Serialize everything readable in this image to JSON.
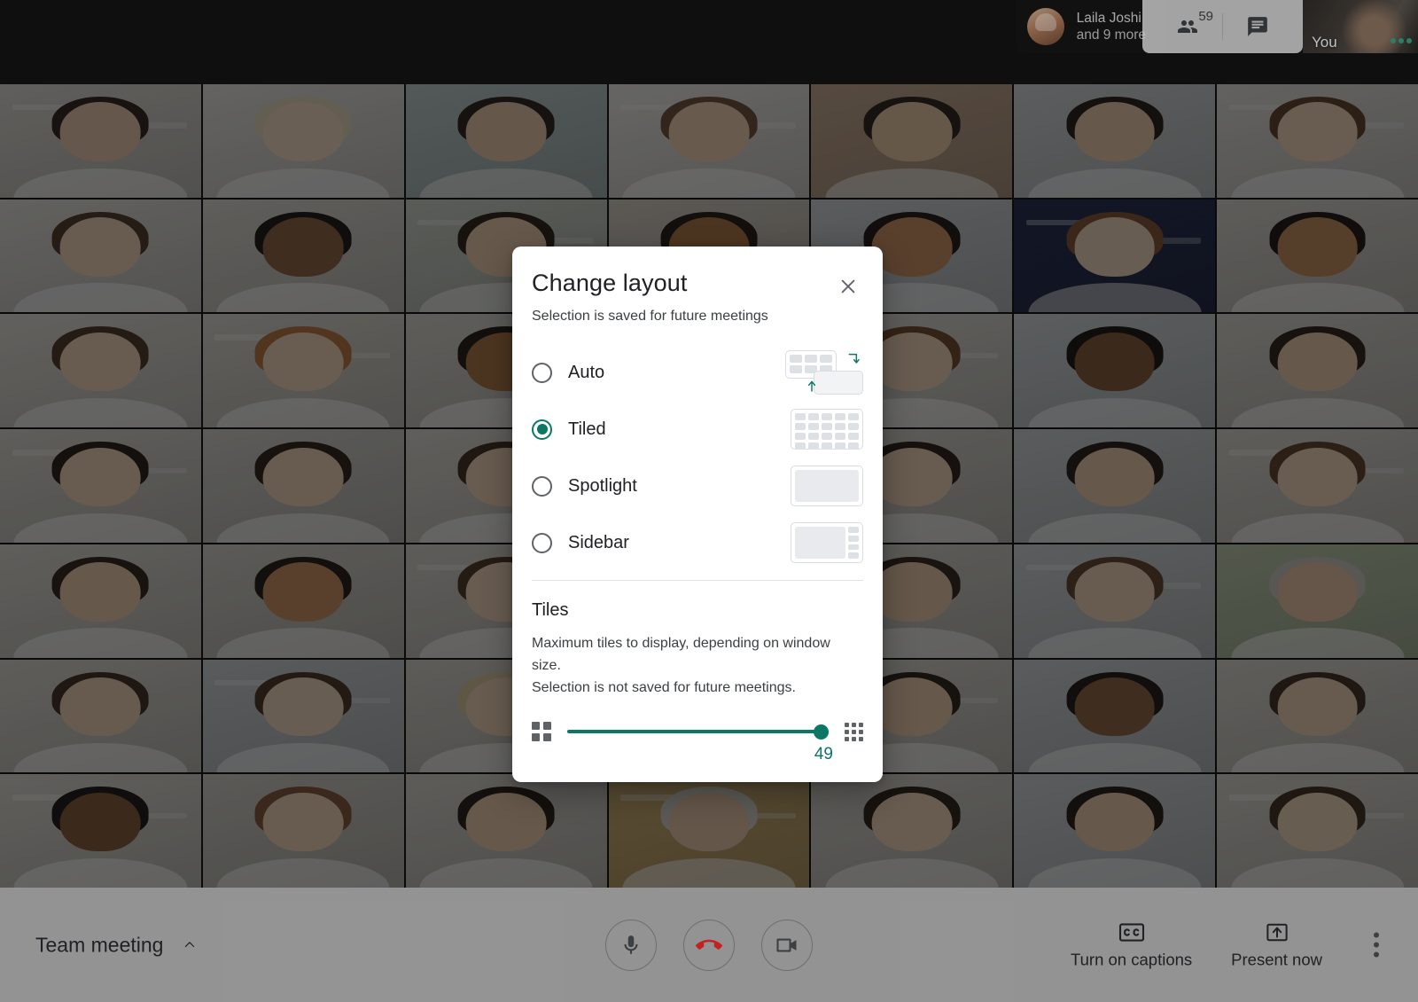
{
  "app": {
    "meeting_name": "Team meeting",
    "self_label": "You"
  },
  "topbar": {
    "participant_name": "Laila Joshi",
    "participant_more": "and 9 more",
    "participants_icon": "people-icon",
    "participants_count": "59",
    "chat_icon": "chat-icon",
    "avatar_name": "avatar"
  },
  "dialog": {
    "title": "Change layout",
    "subtitle": "Selection is saved for future meetings",
    "close_icon": "close-icon",
    "options": [
      {
        "label": "Auto",
        "selected": false,
        "thumb": "auto-layout-thumbnail"
      },
      {
        "label": "Tiled",
        "selected": true,
        "thumb": "tiled-layout-thumbnail"
      },
      {
        "label": "Spotlight",
        "selected": false,
        "thumb": "spotlight-layout-thumbnail"
      },
      {
        "label": "Sidebar",
        "selected": false,
        "thumb": "sidebar-layout-thumbnail"
      }
    ],
    "tiles": {
      "heading": "Tiles",
      "description_line1": "Maximum tiles to display, depending on window size.",
      "description_line2": "Selection is not saved for future meetings.",
      "slider_value": "49",
      "slider_min_icon": "grid-2x2-icon",
      "slider_max_icon": "grid-3x3-icon",
      "slider_percent": 100
    }
  },
  "bottombar": {
    "meeting_label": "Team meeting",
    "expand_icon": "chevron-up-icon",
    "mic_icon": "microphone-icon",
    "hangup_icon": "end-call-icon",
    "camera_icon": "camera-icon",
    "captions_label": "Turn on captions",
    "captions_icon": "closed-captions-icon",
    "present_label": "Present now",
    "present_icon": "present-screen-icon",
    "more_icon": "more-options-icon"
  },
  "colors": {
    "accent_green": "#0b7764",
    "hangup_red": "#c5221f",
    "dialog_bg": "#ffffff",
    "text_primary": "#202124",
    "text_secondary": "#3c4043"
  },
  "grid": {
    "columns": 7,
    "rows": 7,
    "tiles": [
      {
        "skin": "#e6c4a8",
        "hair": "#2b1d16",
        "wall": "#d9d6cf"
      },
      {
        "skin": "#f0d6bd",
        "hair": "#ded4b6",
        "wall": "#e3e1dc"
      },
      {
        "skin": "#e7c5a4",
        "hair": "#241a14",
        "wall": "#b9c9c7"
      },
      {
        "skin": "#eccdae",
        "hair": "#6b4a33",
        "wall": "#e9e7e2"
      },
      {
        "skin": "#e9c7a3",
        "hair": "#231a14",
        "wall": "#c2a58b"
      },
      {
        "skin": "#e8c6a5",
        "hair": "#1f1711",
        "wall": "#cfd4d6"
      },
      {
        "skin": "#f0d3b6",
        "hair": "#5a3a24",
        "wall": "#e0ded8"
      },
      {
        "skin": "#edd0b4",
        "hair": "#4b3424",
        "wall": "#dedcd6"
      },
      {
        "skin": "#8a5c3b",
        "hair": "#171210",
        "wall": "#d8d5cd"
      },
      {
        "skin": "#dcb georg",
        "hair": "#2a1c13",
        "wall": "#c9cfc4"
      },
      {
        "skin": "#a9713f",
        "hair": "#1b1410",
        "wall": "#cfc9bd"
      },
      {
        "skin": "#c98d5e",
        "hair": "#1a1310",
        "wall": "#cbd0d3"
      },
      {
        "skin": "#edd2b8",
        "hair": "#7d4f2c",
        "wall": "#1b2448"
      },
      {
        "skin": "#c28a57",
        "hair": "#160f0c",
        "wall": "#d4d1c9"
      },
      {
        "skin": "#ecd0b2",
        "hair": "#4a3322",
        "wall": "#dedbd3"
      },
      {
        "skin": "#eed2b5",
        "hair": "#b5703a",
        "wall": "#dad6cd"
      },
      {
        "skin": "#a9713f",
        "hair": "#1d1510",
        "wall": "#d6d3cb"
      },
      {
        "skin": "#e7c6a4",
        "hair": "#2b1e15",
        "wall": "#cdd2d5"
      },
      {
        "skin": "#ecd0b3",
        "hair": "#6d4526",
        "wall": "#d9d7d0"
      },
      {
        "skin": "#7e5231",
        "hair": "#14100d",
        "wall": "#cdd3d6"
      },
      {
        "skin": "#e9c8a6",
        "hair": "#2a1d14",
        "wall": "#d5d2ca"
      },
      {
        "skin": "#ead0b0",
        "hair": "#1f1712",
        "wall": "#d7d4cc"
      },
      {
        "skin": "#ecd0b4",
        "hair": "#2a1d15",
        "wall": "#cfcdc7"
      },
      {
        "skin": "#eccfb0",
        "hair": "#3a2819",
        "wall": "#d9d6ce"
      },
      {
        "skin": "#e8c8a7",
        "hair": "#241a13",
        "wall": "#cdd2cf"
      },
      {
        "skin": "#eccfb1",
        "hair": "#241913",
        "wall": "#d2cfc7"
      },
      {
        "skin": "#e9c9a8",
        "hair": "#20160f",
        "wall": "#cbd0d2"
      },
      {
        "skin": "#eed3b6",
        "hair": "#5b3c24",
        "wall": "#d6d3cb"
      },
      {
        "skin": "#e9c8a7",
        "hair": "#2b1e15",
        "wall": "#d8d5cd"
      },
      {
        "skin": "#c98d5e",
        "hair": "#1c1410",
        "wall": "#cfccc4"
      },
      {
        "skin": "#edd1b4",
        "hair": "#46301f",
        "wall": "#d4d1c9"
      },
      {
        "skin": "#eacfb0",
        "hair": "#241a13",
        "wall": "#cfd4d7"
      },
      {
        "skin": "#e7c6a5",
        "hair": "#2d2017",
        "wall": "#d3d0c8"
      },
      {
        "skin": "#ecd1b5",
        "hair": "#5d3f27",
        "wall": "#cdd2d4"
      },
      {
        "skin": "#e6c3a0",
        "hair": "#c9c4bb",
        "wall": "#b9c7a8"
      },
      {
        "skin": "#eacfb1",
        "hair": "#3b2a1b",
        "wall": "#d6d3cb"
      },
      {
        "skin": "#edd2b6",
        "hair": "#44301f",
        "wall": "#c9ced1"
      },
      {
        "skin": "#ecd0b3",
        "hair": "#d6c49a",
        "wall": "#d2cfc7"
      },
      {
        "skin": "#eccfb2",
        "hair": "#6a452a",
        "wall": "#cfd3d5"
      },
      {
        "skin": "#e8c7a6",
        "hair": "#241a13",
        "wall": "#d4d1c9"
      },
      {
        "skin": "#8a5c3b",
        "hair": "#181210",
        "wall": "#cbd0d3"
      },
      {
        "skin": "#eacfb2",
        "hair": "#3c2a1c",
        "wall": "#d7d4cc"
      },
      {
        "skin": "#7e5231",
        "hair": "#15110e",
        "wall": "#d9d6ce"
      },
      {
        "skin": "#ecd1b4",
        "hair": "#7a5130",
        "wall": "#cdcac2"
      },
      {
        "skin": "#e9c8a7",
        "hair": "#1e1610",
        "wall": "#d3d0c8"
      },
      {
        "skin": "#e3c2a3",
        "hair": "#cfcac2",
        "wall": "#c9a96b"
      },
      {
        "skin": "#eccfb1",
        "hair": "#241a13",
        "wall": "#d2cfc7"
      },
      {
        "skin": "#e8c7a5",
        "hair": "#1c1410",
        "wall": "#cbd0d3"
      },
      {
        "skin": "#edd2b5",
        "hair": "#3d2a1b",
        "wall": "#d6d3cb"
      }
    ]
  }
}
